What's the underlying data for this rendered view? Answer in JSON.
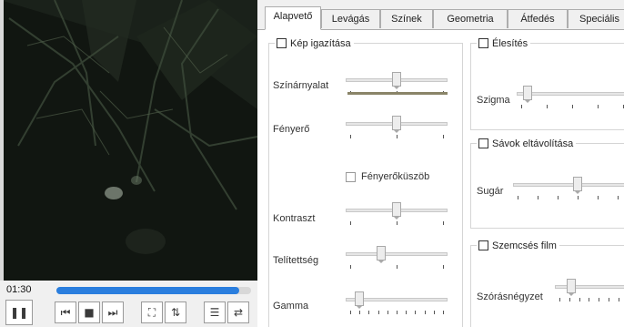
{
  "player": {
    "time": "01:30",
    "progress": 0.94,
    "buttons": [
      {
        "name": "pause-button",
        "icon": "pause-icon",
        "glyph": "❚❚"
      },
      {
        "name": "previous-button",
        "icon": "skip-back-icon",
        "glyph": "⏮"
      },
      {
        "name": "stop-button",
        "icon": "stop-icon",
        "glyph": "■"
      },
      {
        "name": "next-button",
        "icon": "skip-forward-icon",
        "glyph": "⏭"
      },
      {
        "name": "fullscreen-button",
        "icon": "fullscreen-icon",
        "glyph": "⛶"
      },
      {
        "name": "extended-settings-button",
        "icon": "equalizer-icon",
        "glyph": "⇅"
      },
      {
        "name": "playlist-button",
        "icon": "playlist-icon",
        "glyph": "☰"
      },
      {
        "name": "loop-button",
        "icon": "loop-icon",
        "glyph": "⇄"
      }
    ]
  },
  "tabs": [
    "Alapvető",
    "Levágás",
    "Színek",
    "Geometria",
    "Átfedés",
    "Speciális"
  ],
  "active_tab": "Alapvető",
  "image_adjust": {
    "title": "Kép igazítása",
    "checked": false,
    "hue_label": "Színárnyalat",
    "hue_value": 0.5,
    "brightness_label": "Fényerő",
    "brightness_value": 0.5,
    "brightness_threshold_label": "Fényerőküszöb",
    "brightness_threshold_checked": false,
    "contrast_label": "Kontraszt",
    "contrast_value": 0.5,
    "saturation_label": "Telítettség",
    "saturation_value": 0.33,
    "gamma_label": "Gamma",
    "gamma_value": 0.1
  },
  "sharpen": {
    "title": "Élesítés",
    "checked": false,
    "sigma_label": "Szigma",
    "sigma_value": 0.05
  },
  "banding": {
    "title": "Sávok eltávolítása",
    "checked": false,
    "radius_label": "Sugár",
    "radius_value": 0.5
  },
  "film_grain": {
    "title": "Szemcsés film",
    "checked": false,
    "variance_label": "Szórásnégyzet",
    "variance_value": 0.15
  },
  "colors": {
    "seek_fill": "#2a7ede",
    "hue_bar": "#8a8468"
  }
}
